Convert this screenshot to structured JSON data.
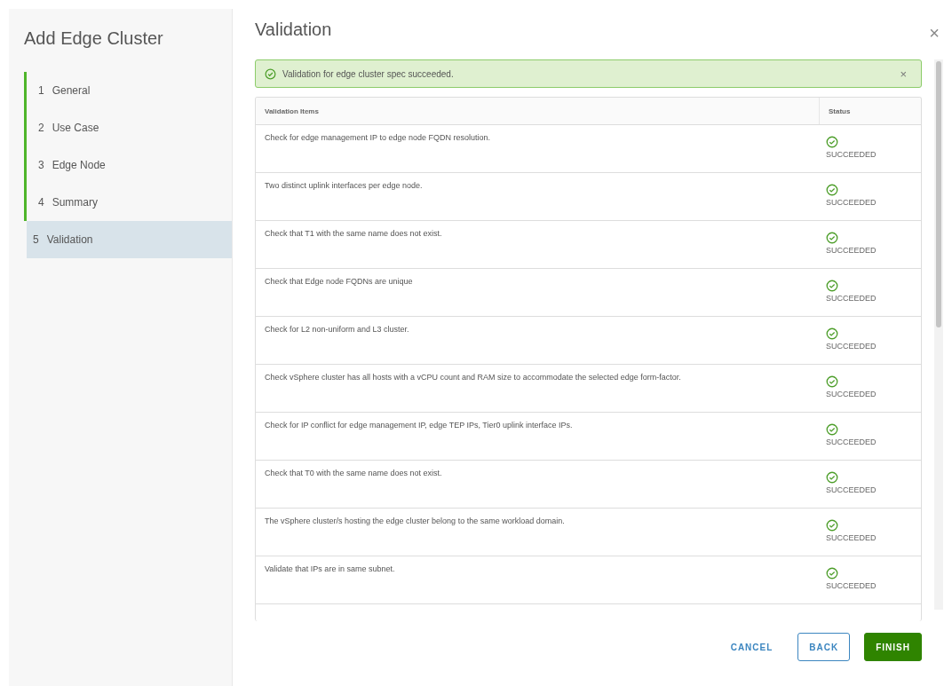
{
  "wizard": {
    "title": "Add Edge Cluster",
    "steps": [
      {
        "number": "1",
        "label": "General",
        "completed": true,
        "selected": false
      },
      {
        "number": "2",
        "label": "Use Case",
        "completed": true,
        "selected": false
      },
      {
        "number": "3",
        "label": "Edge Node",
        "completed": true,
        "selected": false
      },
      {
        "number": "4",
        "label": "Summary",
        "completed": true,
        "selected": false
      },
      {
        "number": "5",
        "label": "Validation",
        "completed": false,
        "selected": true
      }
    ]
  },
  "page": {
    "title": "Validation",
    "close": "×"
  },
  "alert": {
    "kind": "success",
    "text": "Validation for edge cluster spec succeeded.",
    "close": "×"
  },
  "table": {
    "columns": [
      "Validation Items",
      "Status"
    ],
    "rows": [
      {
        "item": "Check for edge management IP to edge node FQDN resolution.",
        "status": "SUCCEEDED",
        "kind": "success"
      },
      {
        "item": "Two distinct uplink interfaces per edge node.",
        "status": "SUCCEEDED",
        "kind": "success"
      },
      {
        "item": "Check that T1 with the same name does not exist.",
        "status": "SUCCEEDED",
        "kind": "success"
      },
      {
        "item": "Check that Edge node FQDNs are unique",
        "status": "SUCCEEDED",
        "kind": "success"
      },
      {
        "item": "Check for L2 non-uniform and L3 cluster.",
        "status": "SUCCEEDED",
        "kind": "success"
      },
      {
        "item": "Check vSphere cluster has all hosts with a vCPU count and RAM size to accommodate the selected edge form-factor.",
        "status": "SUCCEEDED",
        "kind": "success"
      },
      {
        "item": "Check for IP conflict for edge management IP, edge TEP IPs, Tier0 uplink interface IPs.",
        "status": "SUCCEEDED",
        "kind": "success"
      },
      {
        "item": "Check that T0 with the same name does not exist.",
        "status": "SUCCEEDED",
        "kind": "success"
      },
      {
        "item": "The vSphere cluster/s hosting the edge cluster belong to the same workload domain.",
        "status": "SUCCEEDED",
        "kind": "success"
      },
      {
        "item": "Validate that IPs are in same subnet.",
        "status": "SUCCEEDED",
        "kind": "success"
      }
    ]
  },
  "buttons": [
    {
      "label": "CANCEL",
      "kind": "link"
    },
    {
      "label": "BACK",
      "kind": "outline"
    },
    {
      "label": "FINISH",
      "kind": "primary"
    }
  ]
}
